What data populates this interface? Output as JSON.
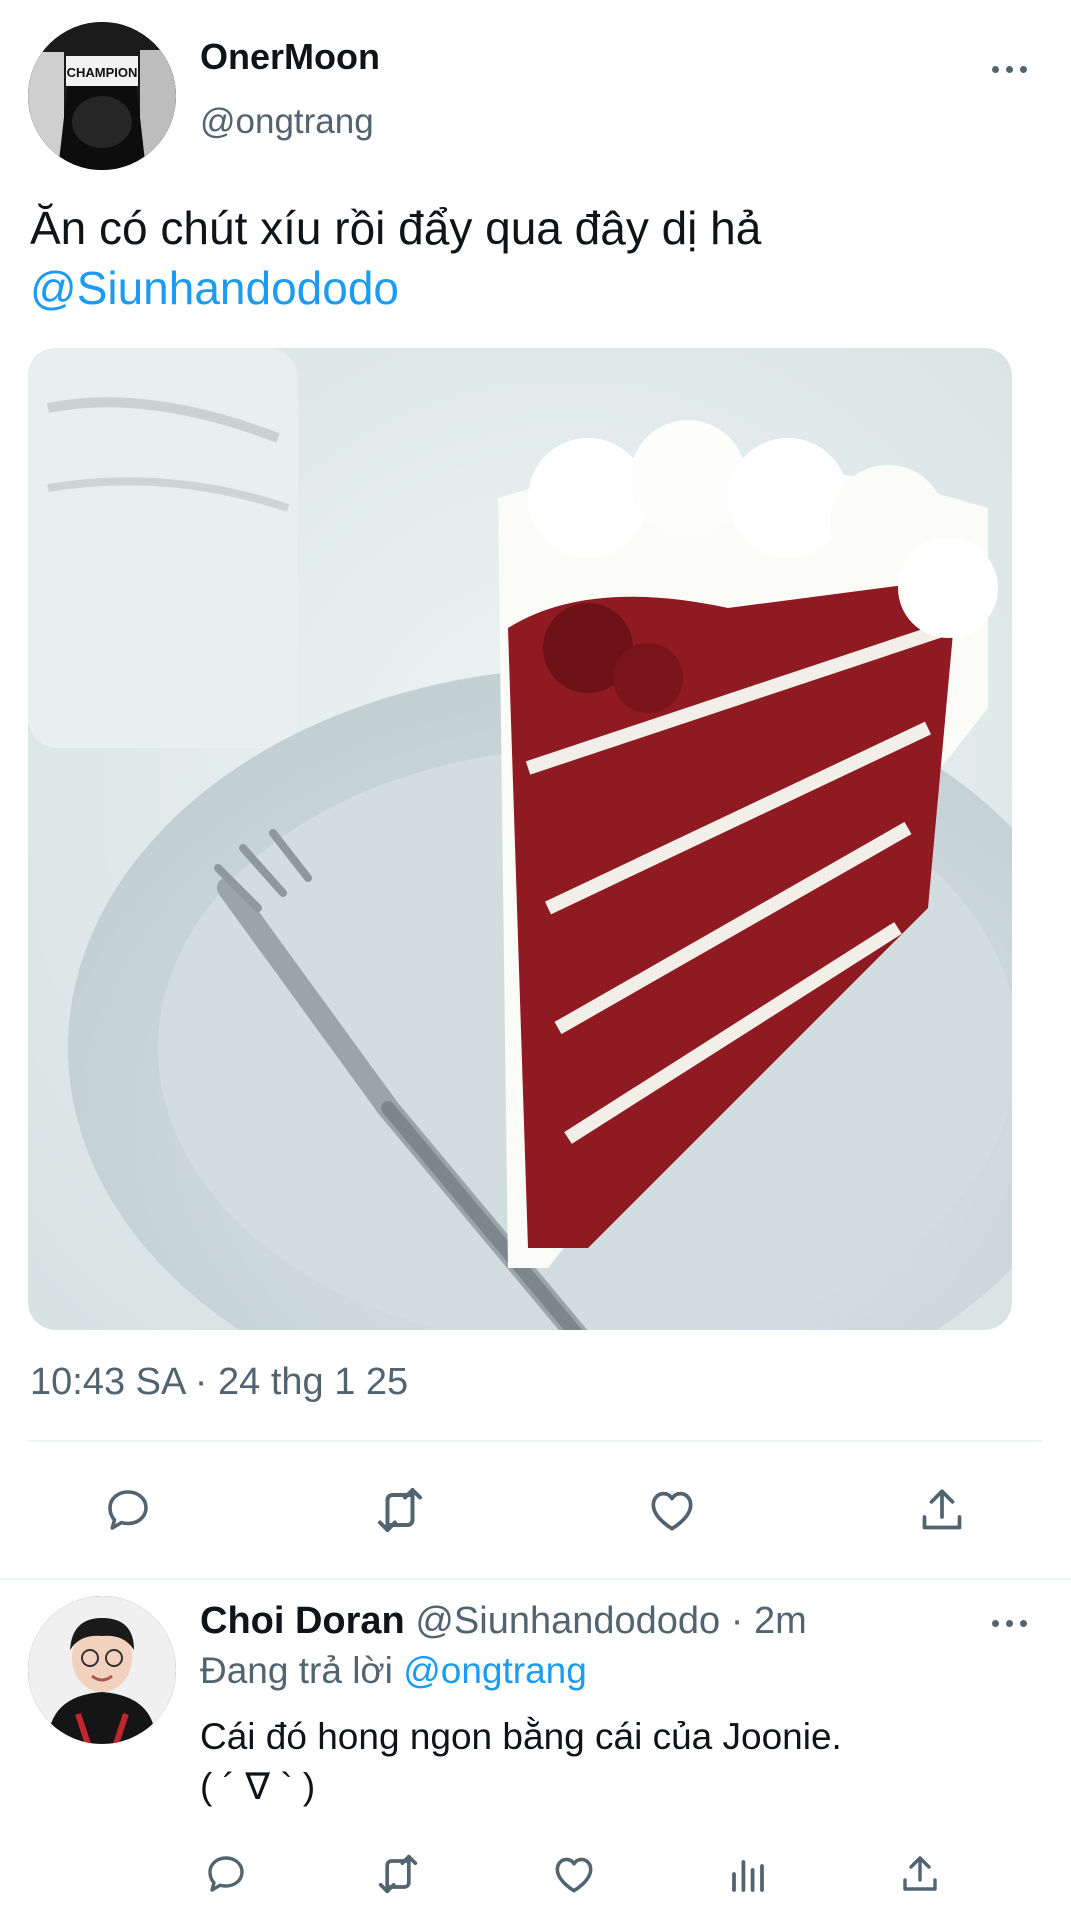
{
  "tweet": {
    "display_name": "OnerMoon",
    "handle": "@ongtrang",
    "avatar_text": "CHAMPION",
    "text_line1": "Ăn có chút xíu rồi đẩy qua đây dị hả",
    "mention": "@Siunhandododo",
    "timestamp": "10:43 SA · 24 thg 1 25",
    "actions": [
      "reply-icon",
      "retweet-icon",
      "like-icon",
      "share-icon"
    ]
  },
  "reply": {
    "display_name": "Choi Doran",
    "handle": "@Siunhandododo",
    "separator": "·",
    "time": "2m",
    "replying_prefix": "Đang trả lời",
    "replying_to": "@ongtrang",
    "text_line1": "Cái đó hong ngon bằng cái của Joonie.",
    "text_line2": "( ´ ∇ ` )",
    "actions": [
      "reply-icon",
      "retweet-icon",
      "like-icon",
      "views-icon",
      "share-icon"
    ]
  },
  "colors": {
    "accent": "#1d9bf0",
    "secondary_text": "#536471",
    "divider": "#eff3f4"
  }
}
